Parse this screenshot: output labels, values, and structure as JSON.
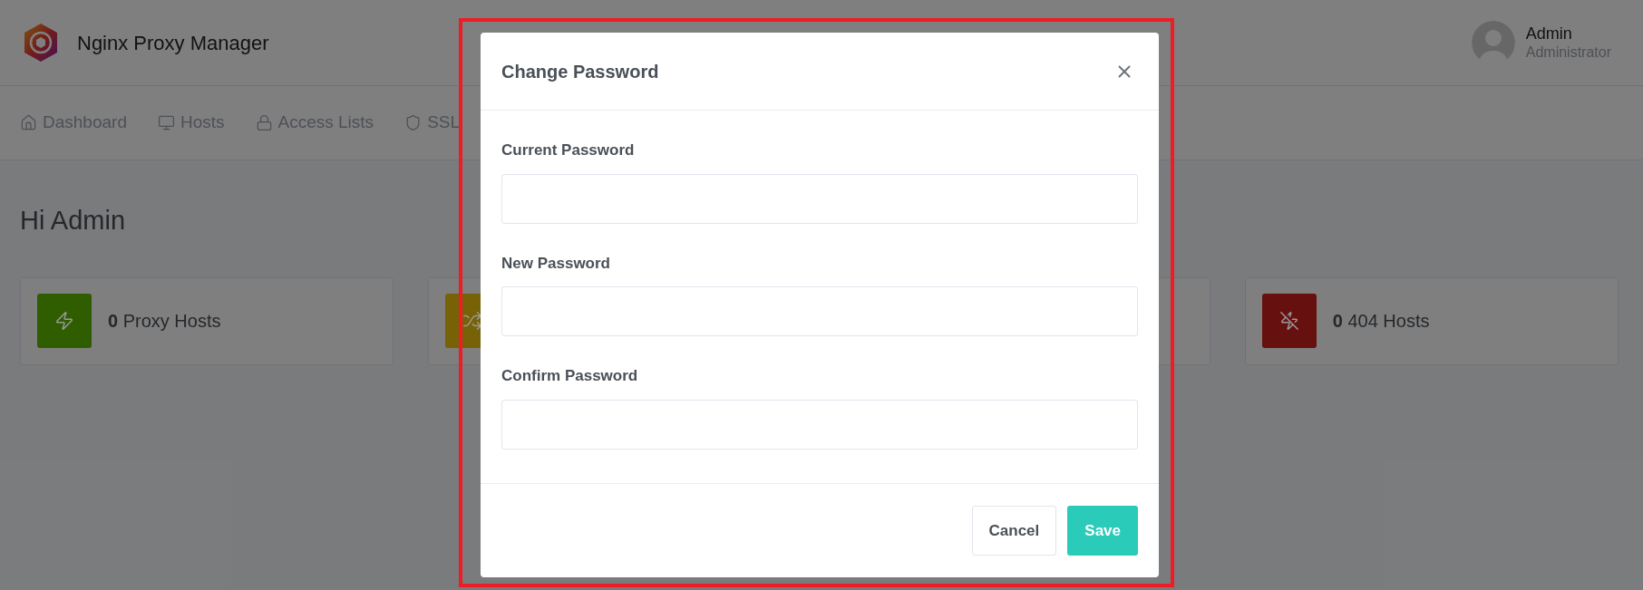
{
  "app": {
    "title": "Nginx Proxy Manager"
  },
  "user": {
    "name": "Admin",
    "role": "Administrator"
  },
  "nav": [
    {
      "label": "Dashboard",
      "kind": "home"
    },
    {
      "label": "Hosts",
      "kind": "monitor"
    },
    {
      "label": "Access Lists",
      "kind": "lock"
    },
    {
      "label": "SSL",
      "kind": "shield"
    }
  ],
  "page_title": "Hi Admin",
  "stats": [
    {
      "kind": "bolt",
      "color": "#2f5d00",
      "count": "0",
      "label": "Proxy Hosts"
    },
    {
      "kind": "shuffle",
      "color": "#786207"
    },
    {
      "kind": "blank"
    },
    {
      "kind": "bolt-off",
      "color": "#66100f",
      "count": "0",
      "label": "404 Hosts"
    }
  ],
  "modal": {
    "title": "Change Password",
    "fields": [
      {
        "label": "Current Password"
      },
      {
        "label": "New Password"
      },
      {
        "label": "Confirm Password"
      }
    ],
    "buttons": [
      {
        "label": "Cancel",
        "kind": "secondary"
      },
      {
        "label": "Save",
        "kind": "primary"
      }
    ]
  }
}
